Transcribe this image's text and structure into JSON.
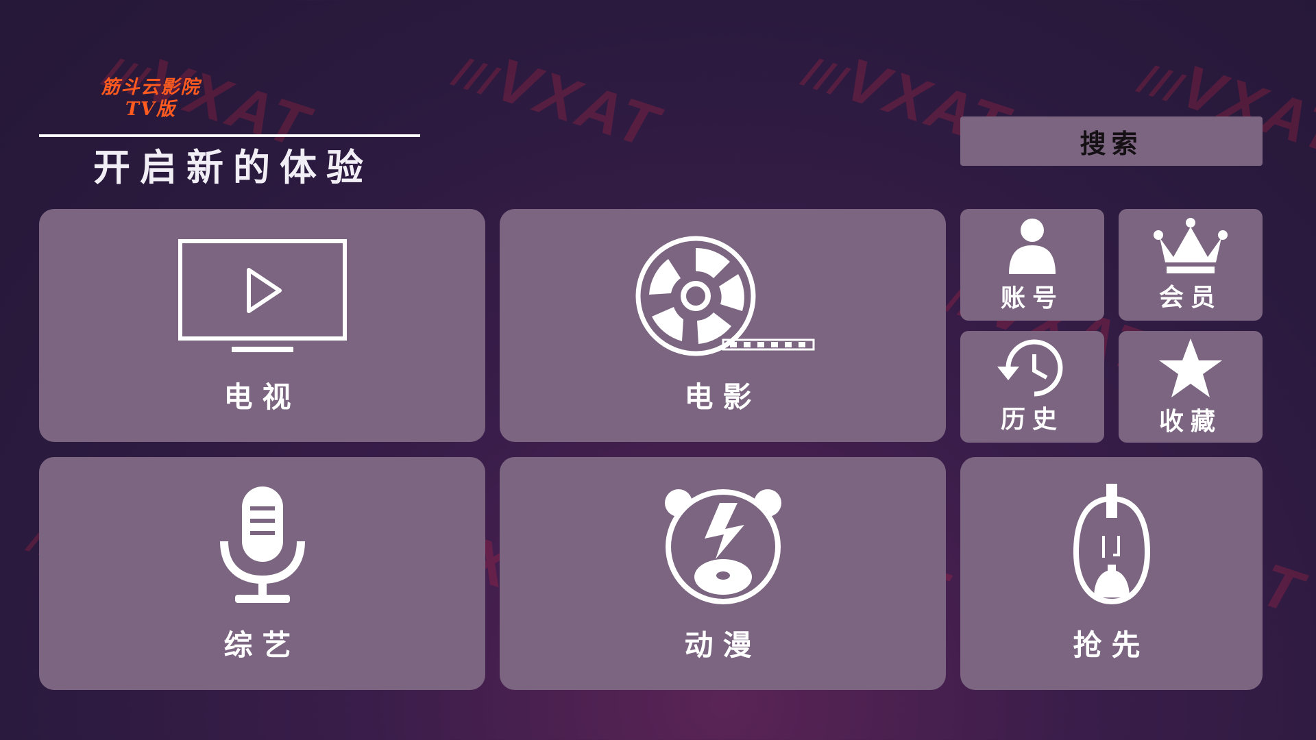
{
  "brand": {
    "line1": "筋斗云影院",
    "line2": "TV版"
  },
  "tagline": "开启新的体验",
  "search": {
    "label": "搜索"
  },
  "tiles": {
    "tv": {
      "label": "电视",
      "icon": "tv-play-icon"
    },
    "movie": {
      "label": "电影",
      "icon": "film-reel-icon"
    },
    "account": {
      "label": "账号",
      "icon": "user-icon"
    },
    "vip": {
      "label": "会员",
      "icon": "crown-icon"
    },
    "history": {
      "label": "历史",
      "icon": "history-clock-icon"
    },
    "favorites": {
      "label": "收藏",
      "icon": "star-icon"
    },
    "variety": {
      "label": "综艺",
      "icon": "microphone-icon"
    },
    "anime": {
      "label": "动漫",
      "icon": "bear-bolt-icon"
    },
    "preview": {
      "label": "抢先",
      "icon": "mouse-figure-icon"
    }
  },
  "watermark": {
    "text": "VXAT",
    "prefix": "///"
  },
  "colors": {
    "background": "#2a1a3e",
    "tile": "#7b6580",
    "brand": "#ff5a1f",
    "watermark": "#e62846"
  }
}
